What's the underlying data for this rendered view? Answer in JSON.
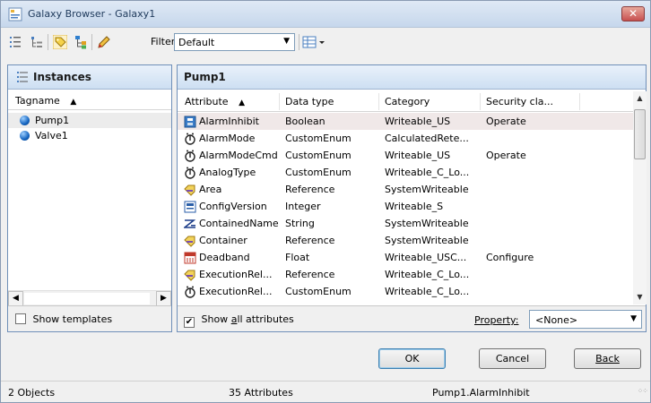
{
  "window": {
    "title": "Galaxy Browser - Galaxy1",
    "close": "✕"
  },
  "toolbar": {
    "filter_label": "Filter:",
    "filter_value": "Default"
  },
  "left": {
    "header": "Instances",
    "column": "Tagname",
    "sort_indicator": "▲",
    "items": [
      {
        "name": "Pump1",
        "selected": true
      },
      {
        "name": "Valve1",
        "selected": false
      }
    ],
    "show_templates": "Show templates",
    "show_templates_checked": false
  },
  "right": {
    "header": "Pump1",
    "columns": [
      "Attribute",
      "Data type",
      "Category",
      "Security cla..."
    ],
    "sort_indicator": "▲",
    "rows": [
      {
        "icon": "boolean-icon",
        "attribute": "AlarmInhibit",
        "type": "Boolean",
        "category": "Writeable_US",
        "security": "Operate",
        "selected": true
      },
      {
        "icon": "custom-enum-icon",
        "attribute": "AlarmMode",
        "type": "CustomEnum",
        "category": "CalculatedRete...",
        "security": ""
      },
      {
        "icon": "custom-enum-icon",
        "attribute": "AlarmModeCmd",
        "type": "CustomEnum",
        "category": "Writeable_US",
        "security": "Operate"
      },
      {
        "icon": "custom-enum-icon",
        "attribute": "AnalogType",
        "type": "CustomEnum",
        "category": "Writeable_C_Lo...",
        "security": ""
      },
      {
        "icon": "reference-icon",
        "attribute": "Area",
        "type": "Reference",
        "category": "SystemWriteable",
        "security": ""
      },
      {
        "icon": "integer-icon",
        "attribute": "ConfigVersion",
        "type": "Integer",
        "category": "Writeable_S",
        "security": ""
      },
      {
        "icon": "string-icon",
        "attribute": "ContainedName",
        "type": "String",
        "category": "SystemWriteable",
        "security": ""
      },
      {
        "icon": "reference-icon",
        "attribute": "Container",
        "type": "Reference",
        "category": "SystemWriteable",
        "security": ""
      },
      {
        "icon": "float-icon",
        "attribute": "Deadband",
        "type": "Float",
        "category": "Writeable_USC...",
        "security": "Configure"
      },
      {
        "icon": "reference-icon",
        "attribute": "ExecutionRel...",
        "type": "Reference",
        "category": "Writeable_C_Lo...",
        "security": ""
      },
      {
        "icon": "custom-enum-icon",
        "attribute": "ExecutionRel...",
        "type": "CustomEnum",
        "category": "Writeable_C_Lo...",
        "security": ""
      }
    ],
    "show_all_prefix": "Show ",
    "show_all_underlined": "a",
    "show_all_rest": "ll attributes",
    "show_all_checked": true,
    "property_label": "Property:",
    "property_value": "<None>"
  },
  "buttons": {
    "ok": "OK",
    "cancel": "Cancel",
    "back": "Back"
  },
  "status": {
    "objects": "2 Objects",
    "attributes": "35 Attributes",
    "selection": "Pump1.AlarmInhibit"
  },
  "glyphs": {
    "dropdown": "▼",
    "left": "◀",
    "right": "▶",
    "up": "▲",
    "down": "▼",
    "check": "✔"
  }
}
